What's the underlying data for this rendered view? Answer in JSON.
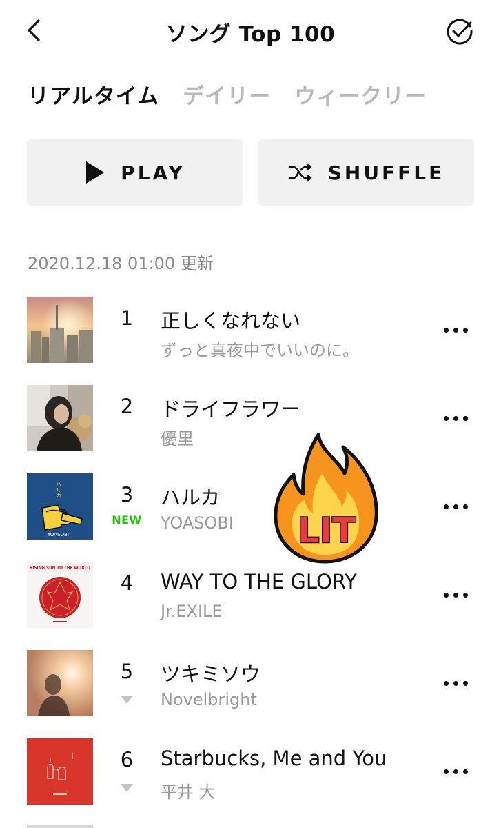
{
  "header": {
    "title": "ソング Top 100"
  },
  "tabs": [
    {
      "label": "リアルタイム",
      "active": true
    },
    {
      "label": "デイリー",
      "active": false
    },
    {
      "label": "ウィークリー",
      "active": false
    }
  ],
  "buttons": {
    "play_label": "PLAY",
    "shuffle_label": "SHUFFLE"
  },
  "updated": "2020.12.18 01:00 更新",
  "songs": [
    {
      "rank": "1",
      "title": "正しくなれない",
      "artist": "ずっと真夜中でいいのに。"
    },
    {
      "rank": "2",
      "title": "ドライフラワー",
      "artist": "優里"
    },
    {
      "rank": "3",
      "title": "ハルカ",
      "artist": "YOASOBI",
      "badge": "NEW"
    },
    {
      "rank": "4",
      "title": "WAY TO THE GLORY",
      "artist": "Jr.EXILE"
    },
    {
      "rank": "5",
      "title": "ツキミソウ",
      "artist": "Novelbright",
      "trend": "down"
    },
    {
      "rank": "6",
      "title": "Starbucks, Me and You",
      "artist": "平井 大",
      "trend": "down"
    }
  ],
  "album_art_text": {
    "haruka_vertical": "ハルカ",
    "haruka_brand": "YOASOBI",
    "rising_sun": "RISING SUN TO THE WORLD"
  },
  "sticker": {
    "label": "LIT"
  },
  "colors": {
    "new_badge": "#1ec800",
    "tab_inactive": "#b9b9b9",
    "button_bg": "#f1f1f1",
    "fire_orange": "#f7941d",
    "fire_yellow": "#ffd44d",
    "lit_red": "#e83b3b"
  },
  "icons": {
    "back": "chevron-left-icon",
    "select": "check-circle-icon",
    "play": "play-icon",
    "shuffle": "shuffle-icon",
    "more": "more-horizontal-icon",
    "trend_down": "triangle-down-icon",
    "sticker": "fire-icon"
  }
}
